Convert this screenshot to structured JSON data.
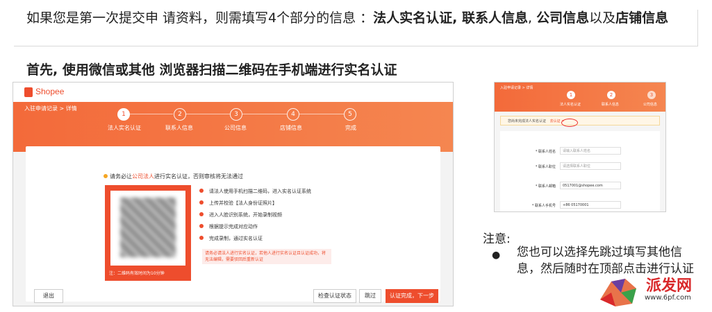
{
  "intro": {
    "prefix": "如果您是第一次提交申 请资料，则需填写4个部分的信息 ：",
    "part1": "法人实名认证,",
    "part2": " 联系人信息",
    "sep": ", ",
    "part3": "公司信息",
    "mid": "以及",
    "part4": "店铺信息"
  },
  "heading": "首先, 使用微信或其他 浏览器扫描二维码在手机端进行实名认证",
  "main_screenshot": {
    "logo": "Shopee",
    "breadcrumb": "入驻申请记录 > 详情",
    "steps": [
      {
        "num": "1",
        "label": "法人实名认证"
      },
      {
        "num": "2",
        "label": "联系人信息"
      },
      {
        "num": "3",
        "label": "公司信息"
      },
      {
        "num": "4",
        "label": "店铺信息"
      },
      {
        "num": "5",
        "label": "完成"
      }
    ],
    "notice_pre": "请务必让",
    "notice_link": "公司法人",
    "notice_post": "进行实名认证，否则审核将无法通过",
    "qr_note": "注：二维码有效时间为10分钟",
    "instructions": [
      "请法人使用手机扫描二维码，进入实名认证系统",
      "上传并校验【法人身份证照片】",
      "进入人脸识别系统，开始录制视频",
      "根据提示完成对应动作",
      "完成录制，通过实名认证"
    ],
    "warning": "请务必请法人进行实名认证，若他人进行实名认证且认证成功，将无法编辑，需要驳回后重新认证",
    "buttons": {
      "exit": "退出",
      "check": "检查认证状态",
      "skip": "跳过",
      "next": "认证完成，下一步"
    }
  },
  "small_screenshot": {
    "breadcrumb": "入驻申请记录 > 详情",
    "steps": [
      {
        "num": "1",
        "label": "法人实名认证"
      },
      {
        "num": "2",
        "label": "联系人信息"
      },
      {
        "num": "3",
        "label": "公司信息"
      }
    ],
    "alert_text": "您尚未完成法人实名认证",
    "alert_link": "去认证 >",
    "fields": [
      {
        "label": "* 联系人姓名",
        "value": "请输入联系人姓名",
        "filled": false
      },
      {
        "label": "* 联系人职位",
        "value": "请选择联系人职位",
        "filled": false
      },
      {
        "label": "* 联系人邮箱",
        "value": "0517001@shopee.com",
        "filled": true
      },
      {
        "label": "* 联系人手机号",
        "value": "+86  05170001",
        "filled": true
      }
    ]
  },
  "note": {
    "title": "注意:",
    "bullet": "●",
    "text": "您也可以选择先跳过填写其他信息，然后随时在顶部点击进行认证"
  },
  "watermark": {
    "brand": "派发网",
    "url": "www.6pf.com"
  },
  "colors": {
    "accent": "#ee4d2d",
    "banner": "#f36a3a"
  }
}
